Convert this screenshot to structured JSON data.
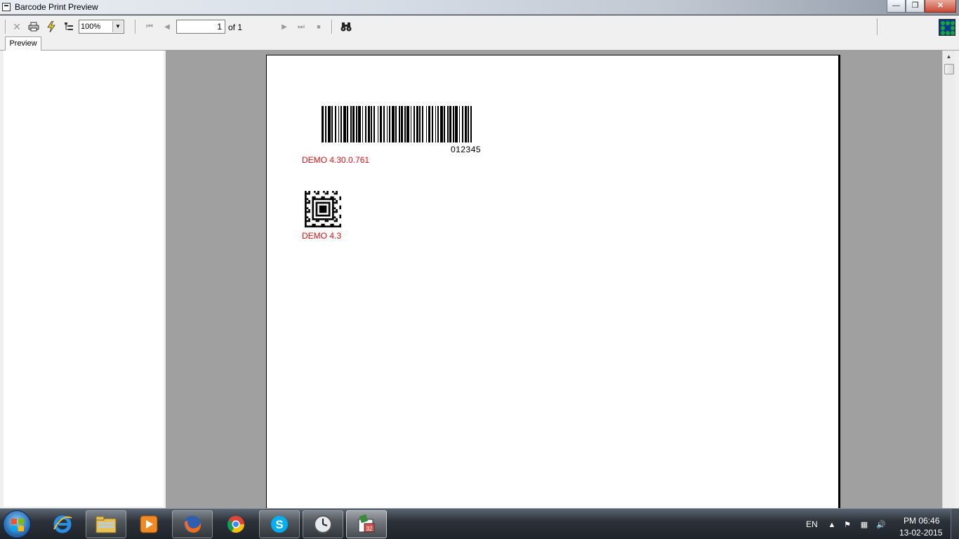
{
  "window": {
    "title": "Barcode Print Preview",
    "minimize_icon": "minimize-icon",
    "maximize_icon": "restore-icon",
    "close_icon": "close-icon"
  },
  "toolbar": {
    "zoom": "100%",
    "page_current": "1",
    "page_of": "of 1",
    "icons": [
      "close-icon",
      "print-icon",
      "lightning-icon",
      "tree-icon",
      "first-page-icon",
      "prev-page-icon",
      "next-page-icon",
      "last-page-icon",
      "stop-icon",
      "binoculars-icon"
    ]
  },
  "tabs": {
    "preview": "Preview"
  },
  "document": {
    "barcode_value": "012345",
    "barcode_caption": "DEMO 4.30.0.761",
    "matrix_caption": "DEMO 4.3"
  },
  "taskbar": {
    "apps": [
      "internet-explorer-icon",
      "file-explorer-icon",
      "media-player-icon",
      "firefox-icon",
      "chrome-icon",
      "skype-icon",
      "clock-icon",
      "barcode-app-icon"
    ],
    "language": "EN",
    "time": "PM 06:46",
    "date": "13-02-2015"
  },
  "colors": {
    "caption_red": "#e01010",
    "viewer_gray": "#a0a0a0",
    "toolbar_bg": "#f0f0f0"
  }
}
